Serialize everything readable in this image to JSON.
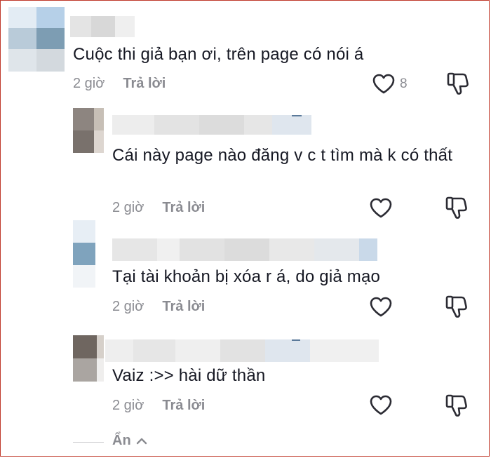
{
  "comments": [
    {
      "text": "Cuộc thi giả bạn ơi, trên page có nói á",
      "time": "2 giờ",
      "reply_label": "Trả lời",
      "like_count": "8"
    },
    {
      "text": "Cái này page nào đăng v c t tìm mà k có thất",
      "time": "2 giờ",
      "reply_label": "Trả lời",
      "like_count": ""
    },
    {
      "text": "Tại tài khoản bị xóa r á, do giả mạo",
      "time": "2 giờ",
      "reply_label": "Trả lời",
      "like_count": ""
    },
    {
      "text": "Vaiz :>> hài dữ thần",
      "time": "2 giờ",
      "reply_label": "Trả lời",
      "like_count": ""
    }
  ],
  "hide_replies": {
    "label": "Ẩn",
    "icon": "chevron-up-icon"
  },
  "icons": {
    "like": "heart-outline-icon",
    "dislike": "thumbs-down-icon"
  },
  "colors": {
    "text": "#161823",
    "muted": "#8a8b91",
    "border": "#c0392b"
  }
}
